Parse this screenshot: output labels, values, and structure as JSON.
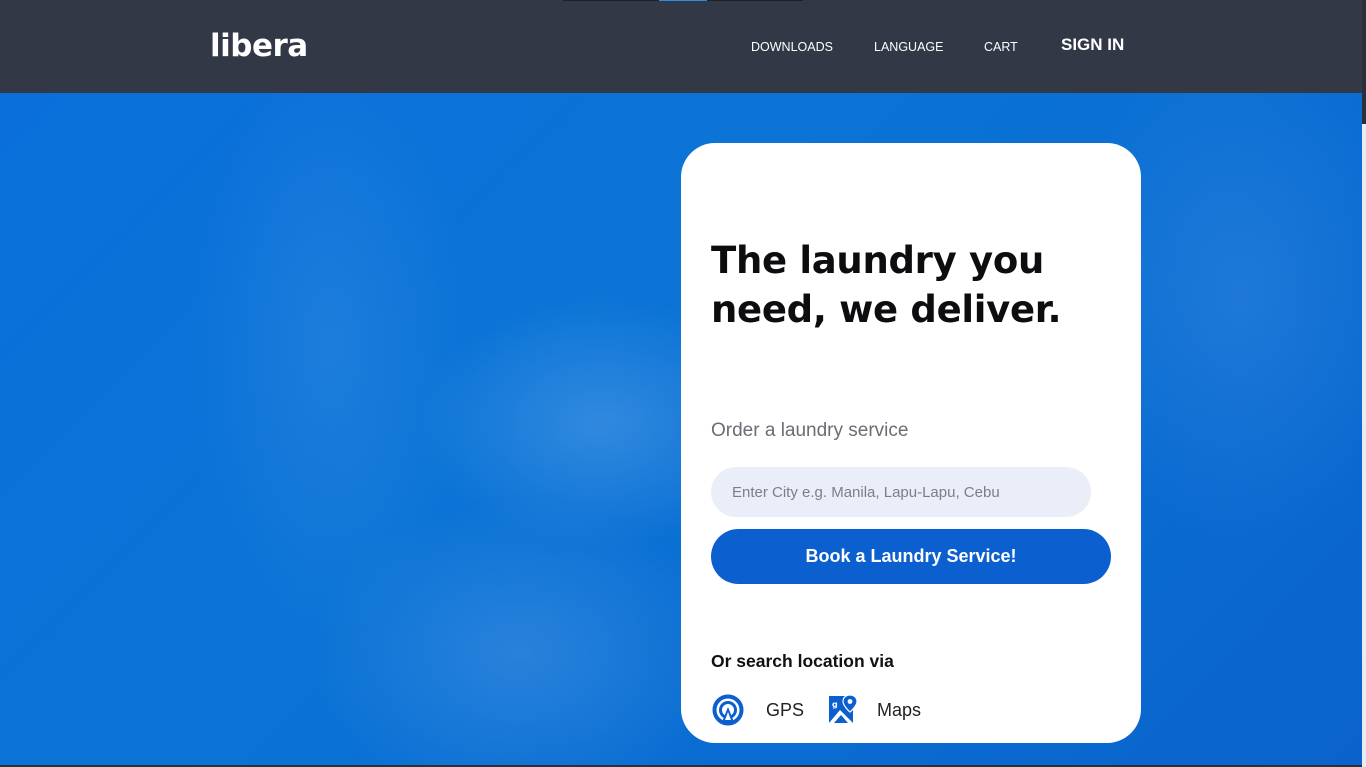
{
  "brand": {
    "logo_text": "libera"
  },
  "nav": {
    "items": [
      {
        "label": "DOWNLOADS"
      },
      {
        "label": "LANGUAGE"
      },
      {
        "label": "CART"
      }
    ],
    "sign_in_label": "SIGN IN"
  },
  "hero": {
    "headline": "The laundry you need, we deliver.",
    "order_label": "Order a laundry service",
    "city_input": {
      "placeholder": "Enter City e.g. Manila, Lapu-Lapu, Cebu",
      "value": ""
    },
    "book_button_label": "Book a Laundry Service!",
    "alt_search_label": "Or search location via",
    "alt_options": [
      {
        "label": "GPS",
        "icon": "gps-icon"
      },
      {
        "label": "Maps",
        "icon": "maps-icon"
      }
    ]
  },
  "colors": {
    "header_bg": "#323846",
    "hero_bg": "#0a6fdb",
    "accent_button": "#0b5fcf",
    "input_bg": "#e9eef8",
    "card_bg": "#ffffff"
  }
}
